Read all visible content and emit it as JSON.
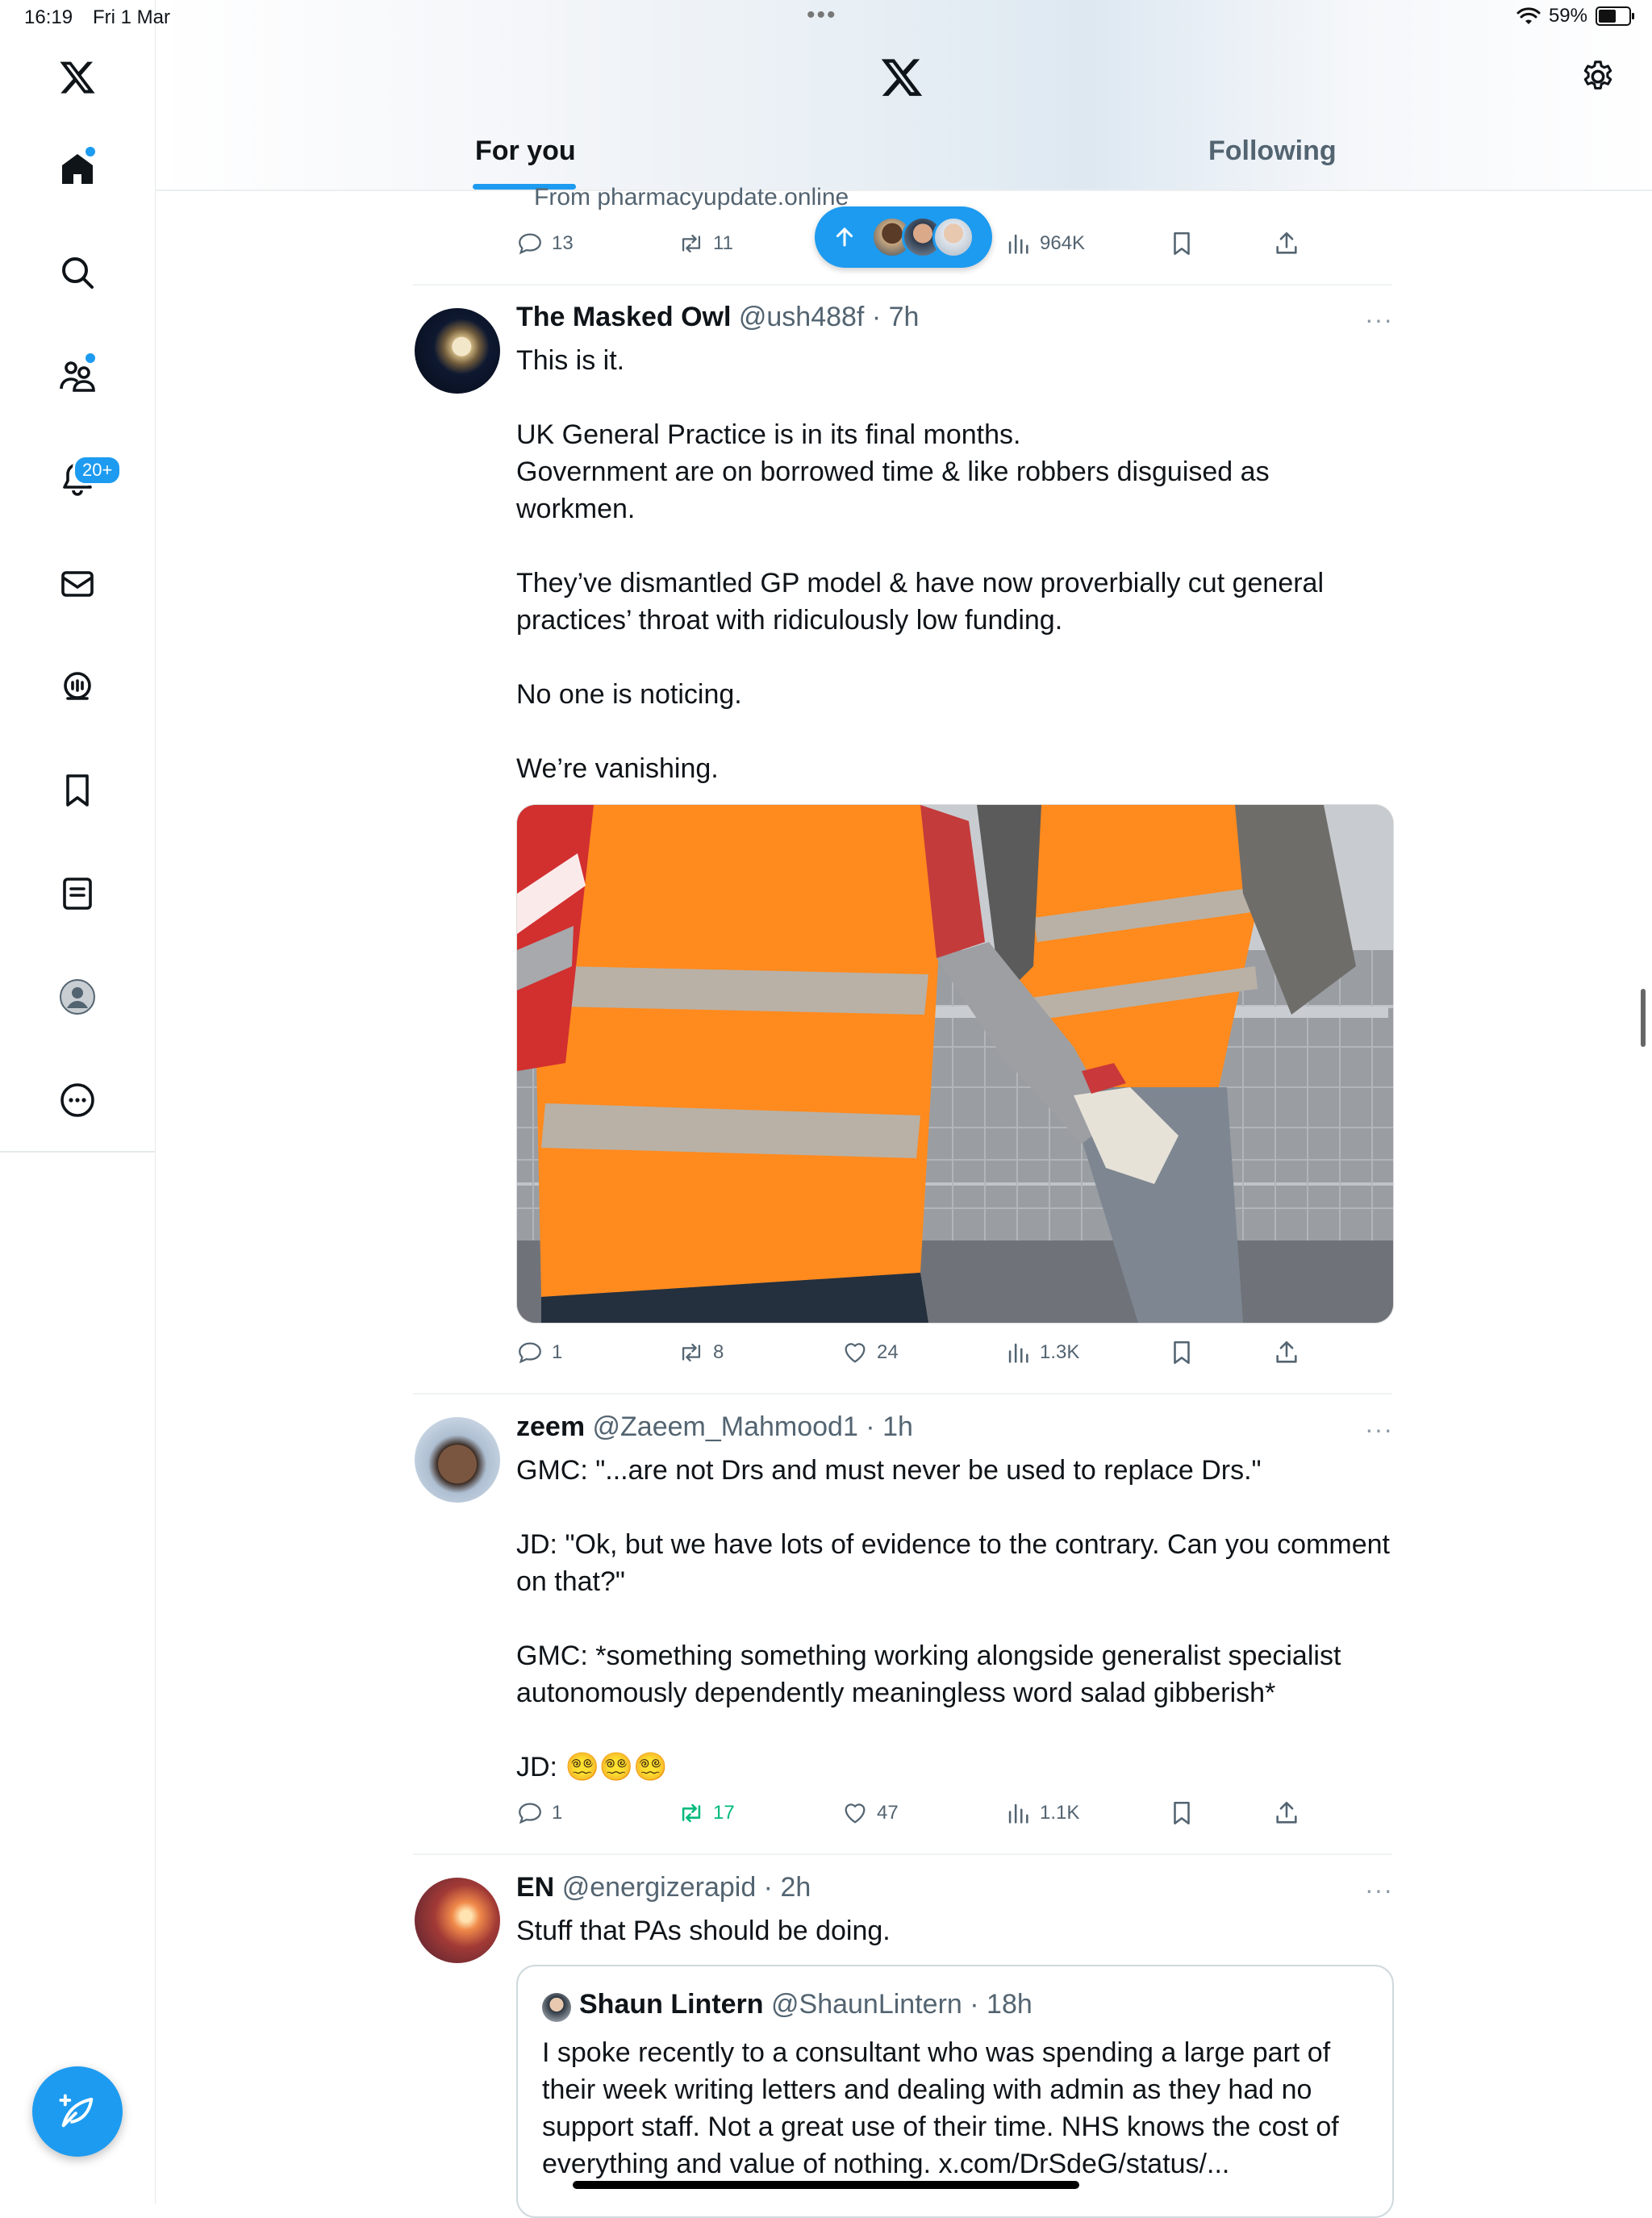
{
  "status_bar": {
    "time": "16:19",
    "date": "Fri 1 Mar",
    "battery": "59%",
    "battery_level": 0.59
  },
  "sidebar": {
    "items": [
      {
        "icon": "home-icon",
        "active": true,
        "dot": true
      },
      {
        "icon": "search-icon"
      },
      {
        "icon": "communities-icon",
        "dot": true
      },
      {
        "icon": "notifications-icon",
        "badge": "20+"
      },
      {
        "icon": "messages-icon"
      },
      {
        "icon": "grok-icon"
      },
      {
        "icon": "bookmarks-icon"
      },
      {
        "icon": "lists-icon"
      },
      {
        "icon": "profile-icon"
      },
      {
        "icon": "more-icon"
      }
    ],
    "notification_badge": "20+",
    "compose_icon": "compose-icon"
  },
  "header": {
    "tabs": [
      {
        "label": "For you",
        "active": true
      },
      {
        "label": "Following",
        "active": false
      }
    ]
  },
  "colors": {
    "accent": "#1d9bf0",
    "text": "#0f1419",
    "secondary": "#536471",
    "retweet_active": "#00ba7c"
  },
  "feed": {
    "partial_post": {
      "source": "From pharmacyupdate.online",
      "replies": "13",
      "reposts": "11",
      "views": "964K"
    },
    "posts": [
      {
        "name": "The Masked Owl",
        "handle": "@ush488f",
        "time": "7h",
        "lines": [
          "This is it.",
          "",
          "UK General Practice is in its final months.",
          "Government are on borrowed time & like robbers disguised as",
          "workmen.",
          "",
          "They’ve dismantled GP model & have now proverbially cut general",
          "practices’ throat with ridiculously low funding.",
          "",
          "No one is noticing.",
          "",
          "We’re vanishing."
        ],
        "replies": "1",
        "reposts": "8",
        "likes": "24",
        "views": "1.3K"
      },
      {
        "name": "zeem",
        "handle": "@Zaeem_Mahmood1",
        "time": "1h",
        "lines": [
          "GMC: \"...are not Drs and must never be used to replace Drs.\"",
          "",
          "JD: \"Ok, but we have lots of evidence to the contrary. Can you comment",
          "on that?\"",
          "",
          "GMC: *something something working alongside generalist specialist",
          "autonomously dependently meaningless word salad gibberish*",
          "",
          "JD: 😵‍💫😵‍💫😵‍💫"
        ],
        "replies": "1",
        "reposts": "17",
        "likes": "47",
        "views": "1.1K"
      },
      {
        "name": "EN",
        "handle": "@energizerapid",
        "time": "2h",
        "lines": [
          "Stuff that PAs should be doing."
        ],
        "quote": {
          "name": "Shaun Lintern",
          "handle": "@ShaunLintern",
          "time": "18h",
          "lines": [
            "I spoke recently to a consultant who was spending a large part of",
            "their week writing letters and dealing with admin as they had no",
            "support staff. Not a great use of their time. NHS knows the cost of",
            "everything and value of nothing. x.com/DrSdeG/status/..."
          ]
        }
      }
    ]
  }
}
